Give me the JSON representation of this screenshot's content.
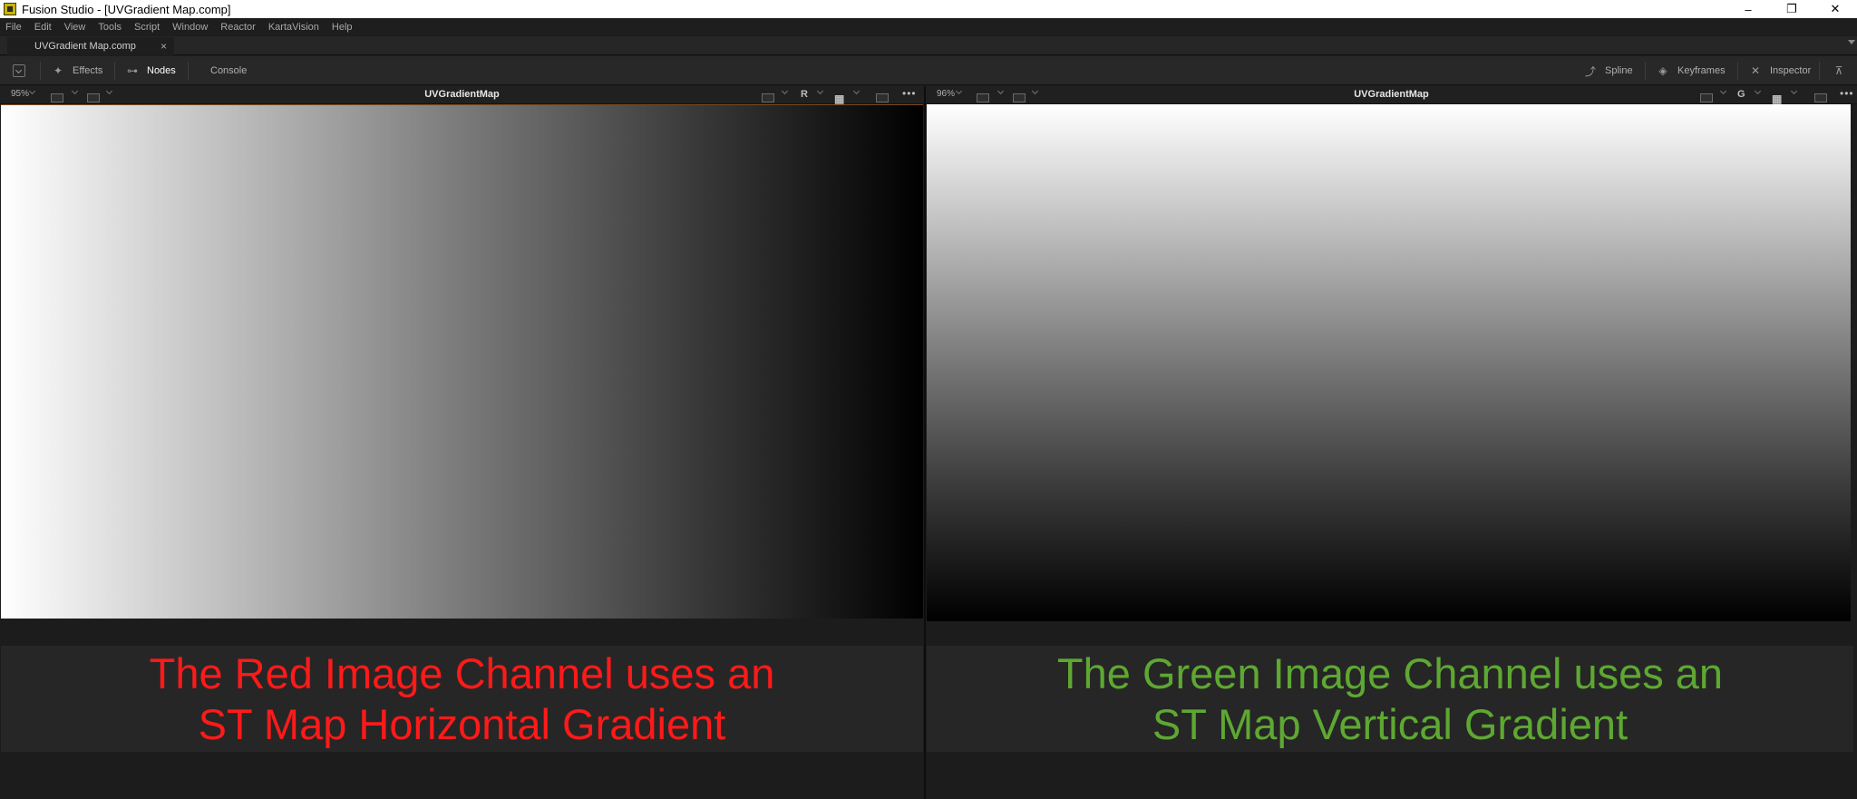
{
  "window": {
    "title": "Fusion Studio - [UVGradient Map.comp]",
    "minimize": "–",
    "restore": "❐",
    "close": "✕"
  },
  "menu": [
    "File",
    "Edit",
    "View",
    "Tools",
    "Script",
    "Window",
    "Reactor",
    "KartaVision",
    "Help"
  ],
  "tabs": {
    "document": "UVGradient Map.comp",
    "close": "×"
  },
  "toolbar": {
    "effects": "Effects",
    "nodes": "Nodes",
    "console": "Console",
    "spline": "Spline",
    "keyframes": "Keyframes",
    "inspector": "Inspector"
  },
  "viewers": [
    {
      "zoom": "95%",
      "title": "UVGradientMap",
      "channel": "R",
      "caption_line1": "The Red Image Channel uses an",
      "caption_line2": "ST Map Horizontal Gradient",
      "caption_color": "#ff1a1a"
    },
    {
      "zoom": "96%",
      "title": "UVGradientMap",
      "channel": "G",
      "caption_line1": "The Green Image Channel uses an",
      "caption_line2": "ST Map Vertical Gradient",
      "caption_color": "#5ea832"
    }
  ],
  "dots": "•••"
}
